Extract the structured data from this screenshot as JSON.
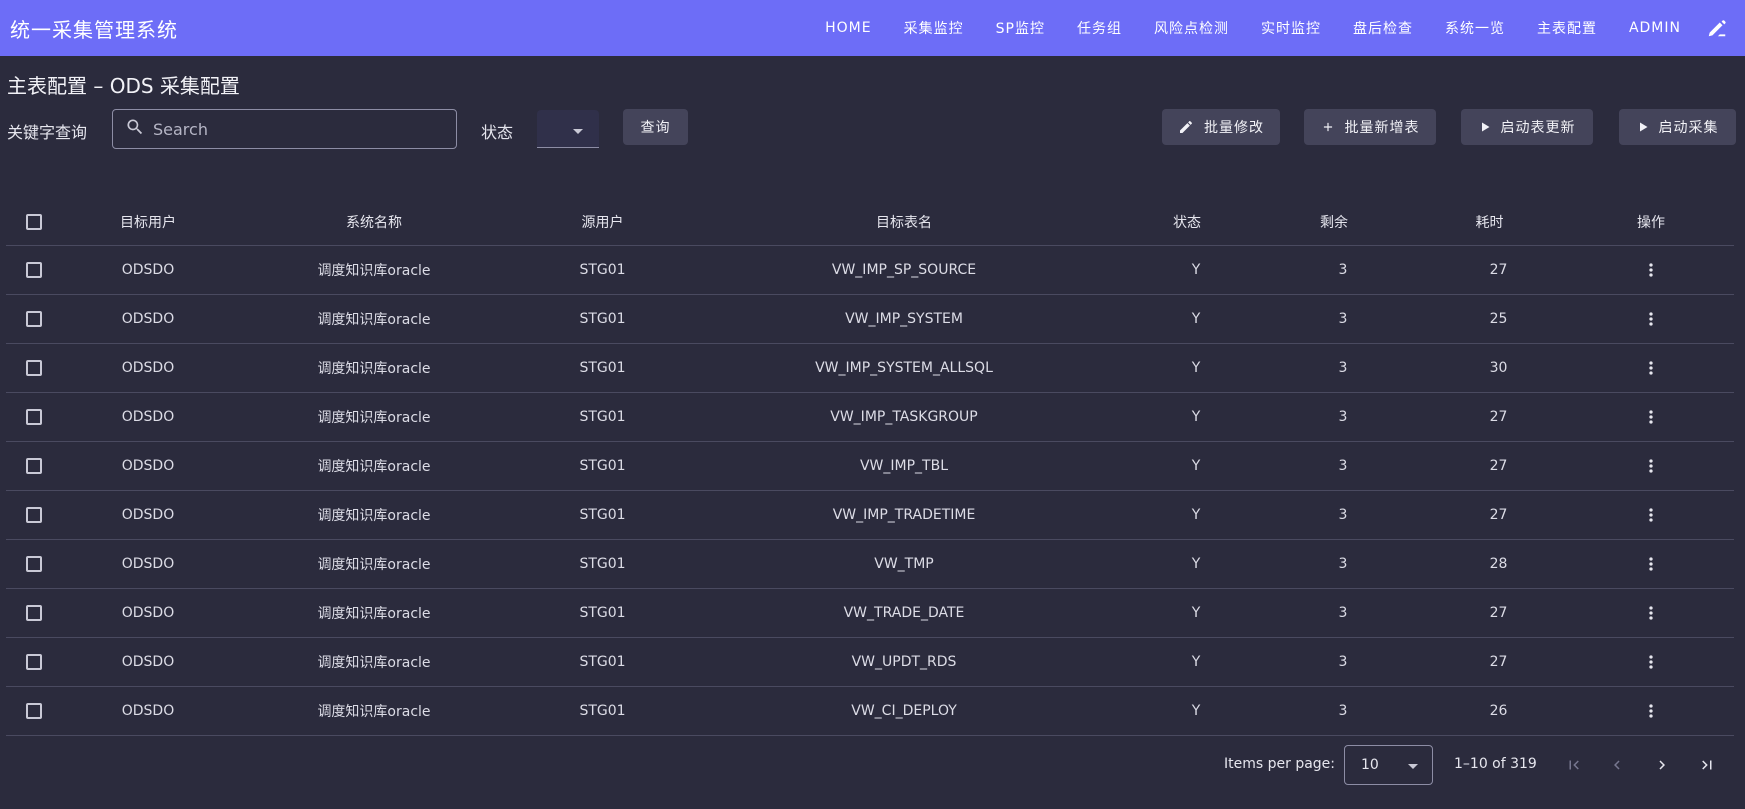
{
  "app": {
    "title": "统一采集管理系统",
    "nav": [
      "HOME",
      "采集监控",
      "SP监控",
      "任务组",
      "风险点检测",
      "实时监控",
      "盘后检查",
      "系统一览",
      "主表配置",
      "ADMIN"
    ],
    "theme_icon": "palette-brush-icon"
  },
  "page": {
    "title": "主表配置 – ODS 采集配置"
  },
  "filters": {
    "keyword_label": "关键字查询",
    "search_placeholder": "Search",
    "search_value": "",
    "status_label": "状态",
    "status_value": "",
    "query_button": "查询"
  },
  "actions": {
    "batch_edit": "批量修改",
    "batch_add": "批量新增表",
    "start_table_update": "启动表更新",
    "start_collect": "启动采集"
  },
  "table": {
    "headers": [
      "目标用户",
      "系统名称",
      "源用户",
      "目标表名",
      "状态",
      "剩余",
      "耗时",
      "操作"
    ],
    "rows": [
      {
        "user": "ODSDO",
        "sys": "调度知识库oracle",
        "src": "STG01",
        "tbl": "VW_IMP_SP_SOURCE",
        "stat": "Y",
        "rem": "3",
        "time": "27"
      },
      {
        "user": "ODSDO",
        "sys": "调度知识库oracle",
        "src": "STG01",
        "tbl": "VW_IMP_SYSTEM",
        "stat": "Y",
        "rem": "3",
        "time": "25"
      },
      {
        "user": "ODSDO",
        "sys": "调度知识库oracle",
        "src": "STG01",
        "tbl": "VW_IMP_SYSTEM_ALLSQL",
        "stat": "Y",
        "rem": "3",
        "time": "30"
      },
      {
        "user": "ODSDO",
        "sys": "调度知识库oracle",
        "src": "STG01",
        "tbl": "VW_IMP_TASKGROUP",
        "stat": "Y",
        "rem": "3",
        "time": "27"
      },
      {
        "user": "ODSDO",
        "sys": "调度知识库oracle",
        "src": "STG01",
        "tbl": "VW_IMP_TBL",
        "stat": "Y",
        "rem": "3",
        "time": "27"
      },
      {
        "user": "ODSDO",
        "sys": "调度知识库oracle",
        "src": "STG01",
        "tbl": "VW_IMP_TRADETIME",
        "stat": "Y",
        "rem": "3",
        "time": "27"
      },
      {
        "user": "ODSDO",
        "sys": "调度知识库oracle",
        "src": "STG01",
        "tbl": "VW_TMP",
        "stat": "Y",
        "rem": "3",
        "time": "28"
      },
      {
        "user": "ODSDO",
        "sys": "调度知识库oracle",
        "src": "STG01",
        "tbl": "VW_TRADE_DATE",
        "stat": "Y",
        "rem": "3",
        "time": "27"
      },
      {
        "user": "ODSDO",
        "sys": "调度知识库oracle",
        "src": "STG01",
        "tbl": "VW_UPDT_RDS",
        "stat": "Y",
        "rem": "3",
        "time": "27"
      },
      {
        "user": "ODSDO",
        "sys": "调度知识库oracle",
        "src": "STG01",
        "tbl": "VW_CI_DEPLOY",
        "stat": "Y",
        "rem": "3",
        "time": "26"
      }
    ]
  },
  "paginator": {
    "items_per_page_label": "Items per page:",
    "page_size": "10",
    "range": "1–10 of 319"
  },
  "colors": {
    "header_bg": "#6d6df7",
    "page_bg": "#2b2b3d",
    "button_bg": "#44445a"
  }
}
